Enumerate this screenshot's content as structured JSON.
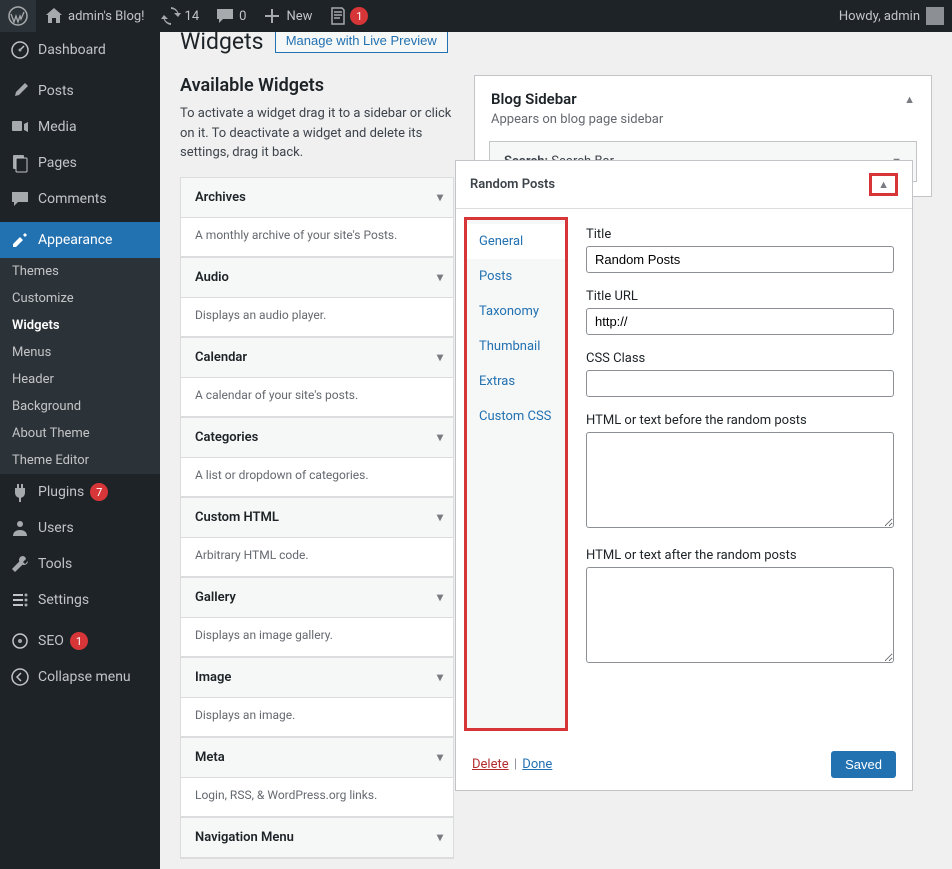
{
  "adminbar": {
    "site_name": "admin's Blog!",
    "updates_count": "14",
    "comments_count": "0",
    "new_label": "New",
    "notif_count": "1",
    "howdy": "Howdy, admin"
  },
  "menu": {
    "dashboard": "Dashboard",
    "posts": "Posts",
    "media": "Media",
    "pages": "Pages",
    "comments": "Comments",
    "appearance": "Appearance",
    "appearance_sub": [
      "Themes",
      "Customize",
      "Widgets",
      "Menus",
      "Header",
      "Background",
      "About Theme",
      "Theme Editor"
    ],
    "plugins": "Plugins",
    "plugins_count": "7",
    "users": "Users",
    "tools": "Tools",
    "settings": "Settings",
    "seo": "SEO",
    "seo_count": "1",
    "collapse": "Collapse menu"
  },
  "page": {
    "title": "Widgets",
    "live_preview": "Manage with Live Preview",
    "available_heading": "Available Widgets",
    "available_desc": "To activate a widget drag it to a sidebar or click on it. To deactivate a widget and delete its settings, drag it back."
  },
  "available": [
    {
      "name": "Archives",
      "desc": "A monthly archive of your site's Posts."
    },
    {
      "name": "Audio",
      "desc": "Displays an audio player."
    },
    {
      "name": "Calendar",
      "desc": "A calendar of your site's posts."
    },
    {
      "name": "Categories",
      "desc": "A list or dropdown of categories."
    },
    {
      "name": "Custom HTML",
      "desc": "Arbitrary HTML code."
    },
    {
      "name": "Gallery",
      "desc": "Displays an image gallery."
    },
    {
      "name": "Image",
      "desc": "Displays an image."
    },
    {
      "name": "Meta",
      "desc": "Login, RSS, & WordPress.org links."
    },
    {
      "name": "Navigation Menu",
      "desc": ""
    }
  ],
  "sidebar_area": {
    "title": "Blog Sidebar",
    "desc": "Appears on blog page sidebar",
    "search_label": "Search:",
    "search_name": "Search Bar"
  },
  "random": {
    "header": "Random Posts",
    "tabs": [
      "General",
      "Posts",
      "Taxonomy",
      "Thumbnail",
      "Extras",
      "Custom CSS"
    ],
    "title_label": "Title",
    "title_value": "Random Posts",
    "titleurl_label": "Title URL",
    "titleurl_value": "http://",
    "css_label": "CSS Class",
    "before_label": "HTML or text before the random posts",
    "after_label": "HTML or text after the random posts",
    "delete": "Delete",
    "done": "Done",
    "saved": "Saved"
  }
}
